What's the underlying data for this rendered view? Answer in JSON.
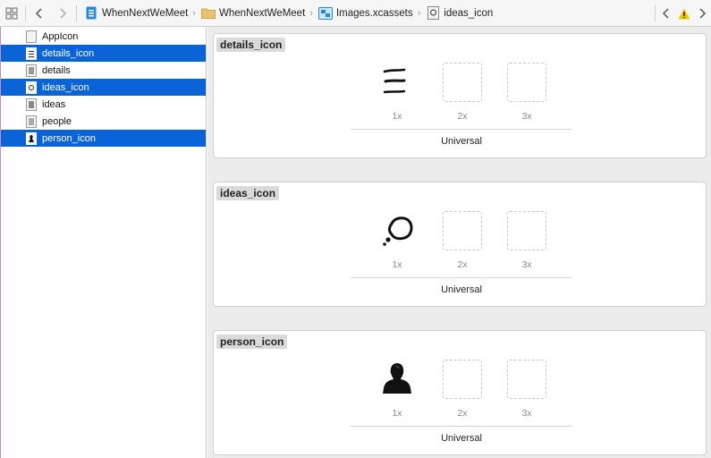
{
  "jumpbar": {
    "breadcrumbs": [
      {
        "label": "WhenNextWeMeet",
        "icon": "project-file-icon"
      },
      {
        "label": "WhenNextWeMeet",
        "icon": "folder-icon"
      },
      {
        "label": "Images.xcassets",
        "icon": "asset-catalog-icon"
      },
      {
        "label": "ideas_icon",
        "icon": "image-set-icon"
      }
    ]
  },
  "sidebar": {
    "items": [
      {
        "label": "AppIcon",
        "selected": false
      },
      {
        "label": "details_icon",
        "selected": true
      },
      {
        "label": "details",
        "selected": false
      },
      {
        "label": "ideas_icon",
        "selected": true
      },
      {
        "label": "ideas",
        "selected": false
      },
      {
        "label": "people",
        "selected": false
      },
      {
        "label": "person_icon",
        "selected": true
      }
    ]
  },
  "main": {
    "sets": [
      {
        "title": "details_icon",
        "slots": [
          "1x",
          "2x",
          "3x"
        ],
        "footer": "Universal",
        "image": "details-lines-icon"
      },
      {
        "title": "ideas_icon",
        "slots": [
          "1x",
          "2x",
          "3x"
        ],
        "footer": "Universal",
        "image": "thought-bubble-icon"
      },
      {
        "title": "person_icon",
        "slots": [
          "1x",
          "2x",
          "3x"
        ],
        "footer": "Universal",
        "image": "person-silhouette-icon"
      }
    ]
  },
  "colors": {
    "selection": "#0a64d6",
    "warning": "#f5c400",
    "folder": "#e9c46a",
    "file_blue": "#2a86d9"
  }
}
